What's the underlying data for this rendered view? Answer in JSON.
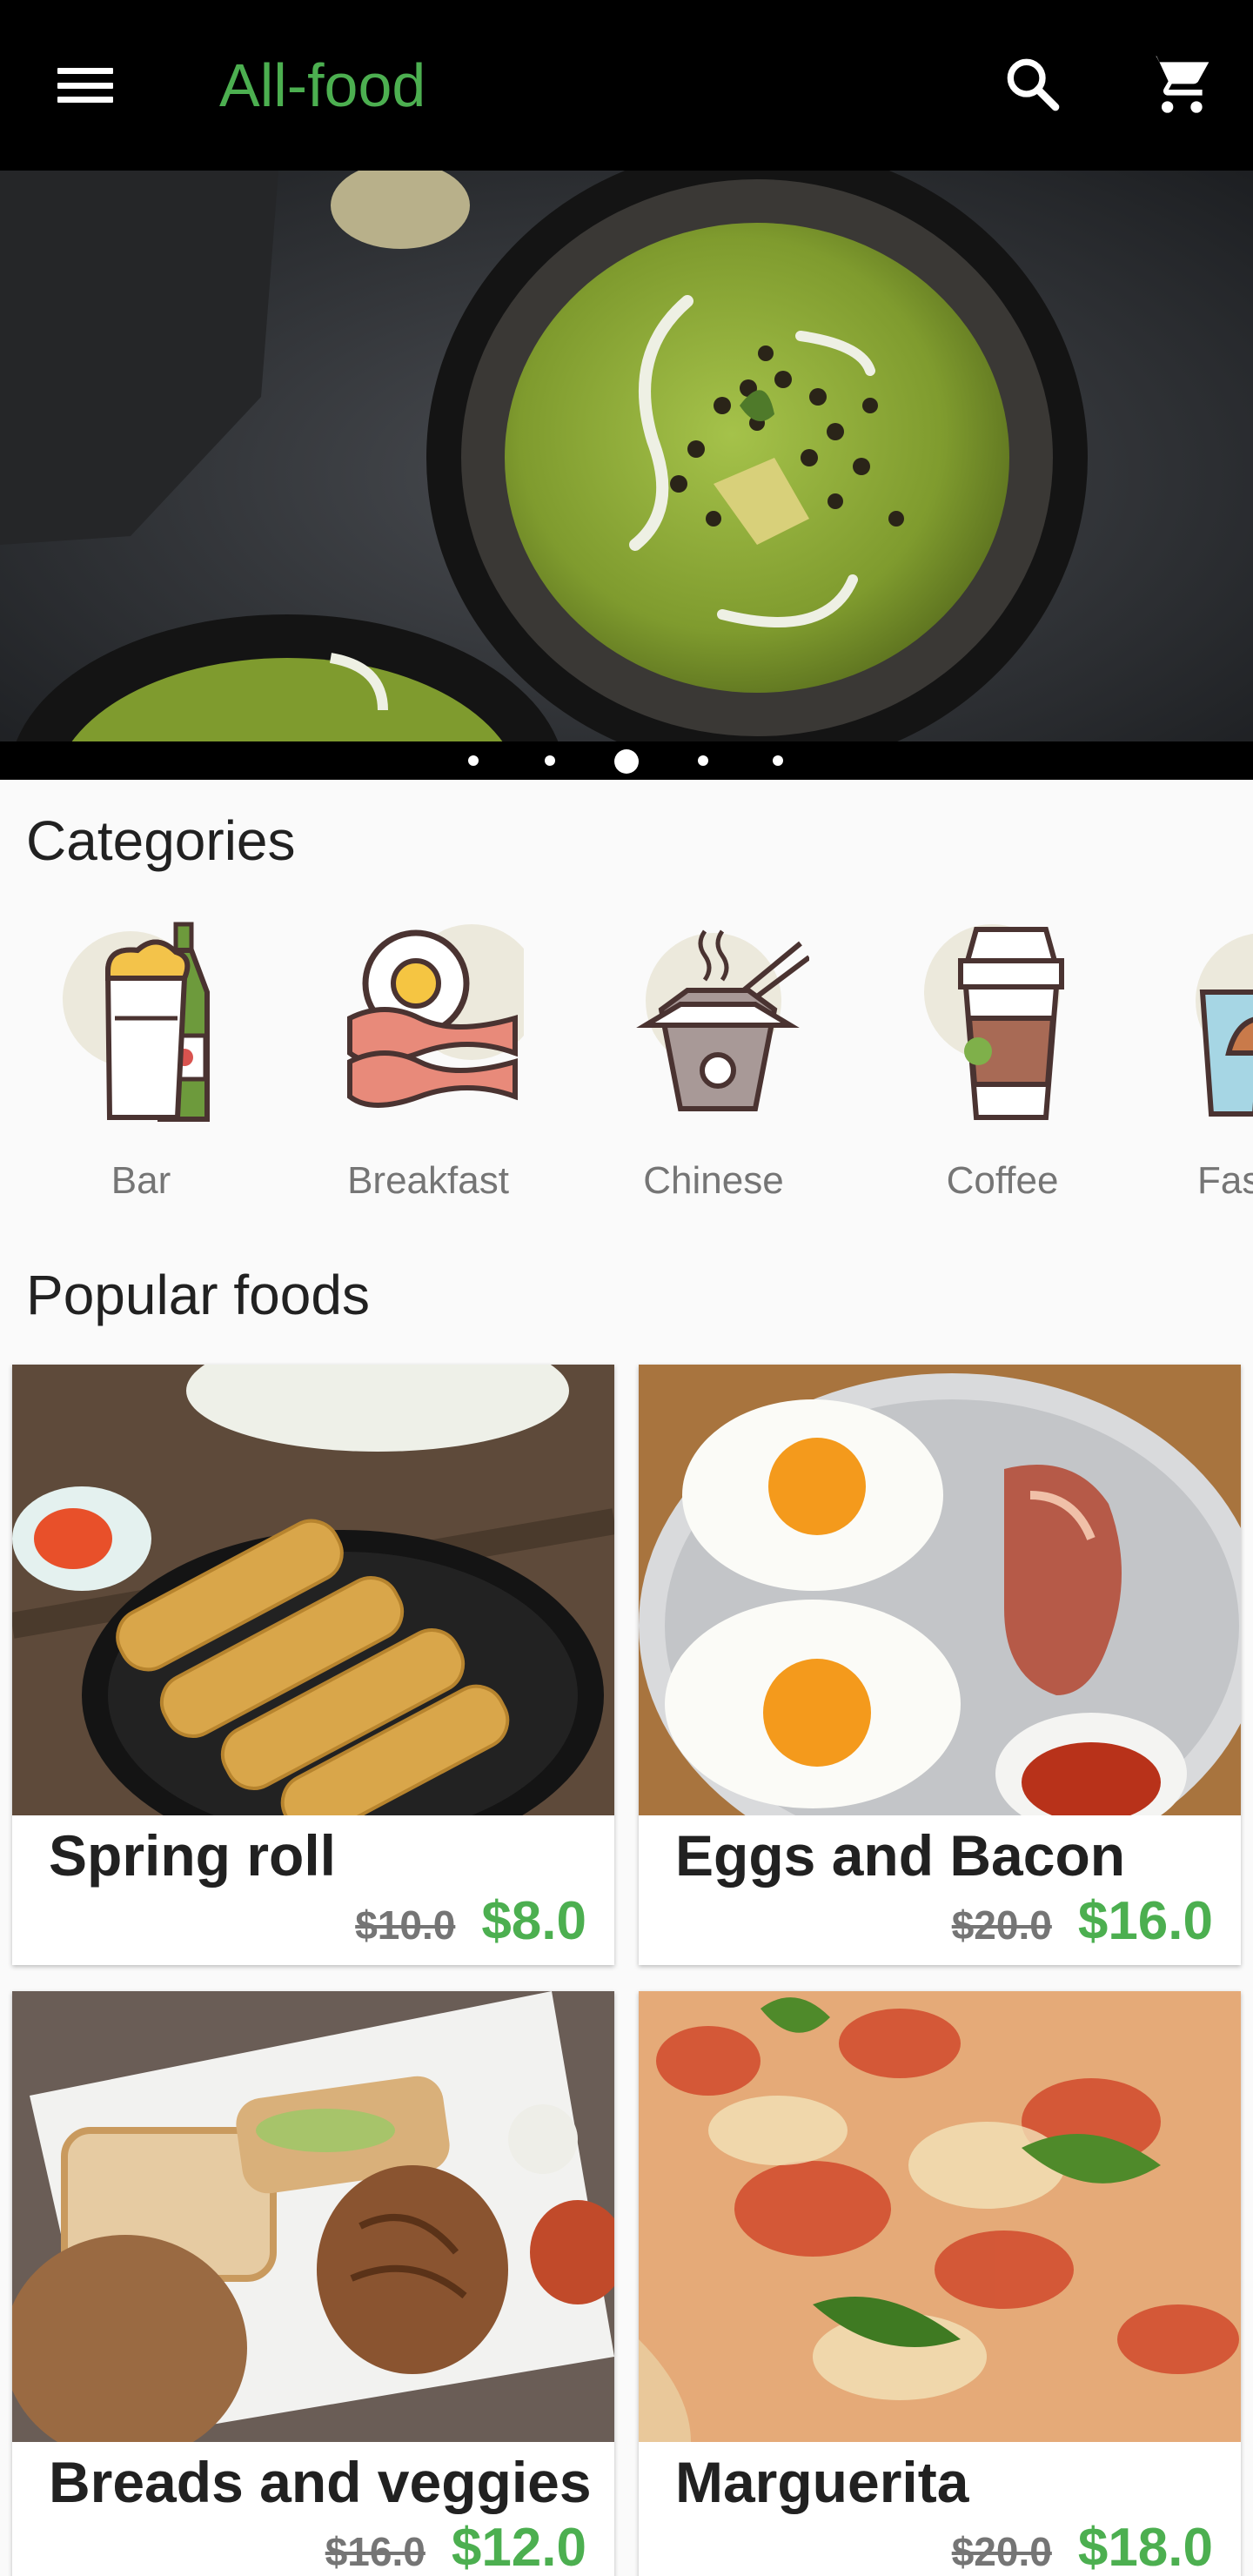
{
  "app": {
    "title": "All-food"
  },
  "colors": {
    "accent": "#4caf50",
    "appbar": "#000000",
    "old_price": "#757575"
  },
  "banner": {
    "slides": 5,
    "active_index": 2
  },
  "categories_section": {
    "title": "Categories",
    "items": [
      {
        "label": "Bar",
        "icon": "beer-bottle-icon"
      },
      {
        "label": "Breakfast",
        "icon": "egg-bacon-icon"
      },
      {
        "label": "Chinese",
        "icon": "noodle-box-icon"
      },
      {
        "label": "Coffee",
        "icon": "coffee-cup-icon"
      },
      {
        "label": "Fas",
        "icon": "fast-food-icon"
      }
    ]
  },
  "popular_section": {
    "title": "Popular foods",
    "items": [
      {
        "name": "Spring roll",
        "old_price": "$10.0",
        "price": "$8.0"
      },
      {
        "name": "Eggs and Bacon",
        "old_price": "$20.0",
        "price": "$16.0"
      },
      {
        "name": "Breads and veggies",
        "old_price": "$16.0",
        "price": "$12.0"
      },
      {
        "name": "Marguerita",
        "old_price": "$20.0",
        "price": "$18.0"
      }
    ]
  }
}
